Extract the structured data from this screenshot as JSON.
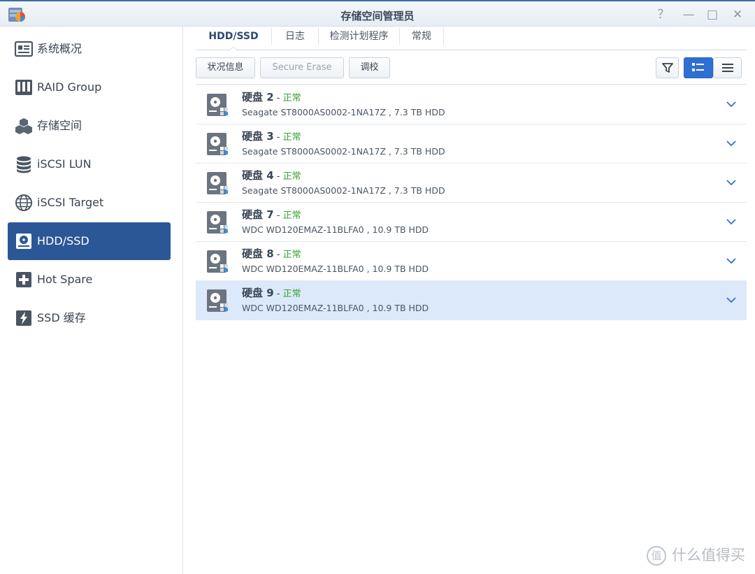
{
  "window": {
    "title": "存储空间管理员",
    "help_glyph": "？",
    "minimize_glyph": "—",
    "maximize_glyph": "□",
    "close_glyph": "✕"
  },
  "sidebar": {
    "items": [
      {
        "label": "系统概况",
        "icon": "overview-icon",
        "active": false
      },
      {
        "label": "RAID Group",
        "icon": "raid-group-icon",
        "active": false
      },
      {
        "label": "存储空间",
        "icon": "storage-pool-icon",
        "active": false
      },
      {
        "label": "iSCSI LUN",
        "icon": "database-icon",
        "active": false
      },
      {
        "label": "iSCSI Target",
        "icon": "globe-icon",
        "active": false
      },
      {
        "label": "HDD/SSD",
        "icon": "hdd-icon",
        "active": true
      },
      {
        "label": "Hot Spare",
        "icon": "hot-spare-icon",
        "active": false
      },
      {
        "label": "SSD 缓存",
        "icon": "ssd-cache-icon",
        "active": false
      }
    ]
  },
  "tabs": [
    {
      "label": "HDD/SSD",
      "active": true
    },
    {
      "label": "日志",
      "active": false
    },
    {
      "label": "检测计划程序",
      "active": false
    },
    {
      "label": "常规",
      "active": false
    }
  ],
  "toolbar": {
    "status_info": "状况信息",
    "secure_erase": "Secure Erase",
    "calibrate": "调校"
  },
  "disks": [
    {
      "name": "硬盘 2",
      "status": "正常",
      "detail": "Seagate ST8000AS0002-1NA17Z , 7.3 TB HDD",
      "selected": false
    },
    {
      "name": "硬盘 3",
      "status": "正常",
      "detail": "Seagate ST8000AS0002-1NA17Z , 7.3 TB HDD",
      "selected": false
    },
    {
      "name": "硬盘 4",
      "status": "正常",
      "detail": "Seagate ST8000AS0002-1NA17Z , 7.3 TB HDD",
      "selected": false
    },
    {
      "name": "硬盘 7",
      "status": "正常",
      "detail": "WDC WD120EMAZ-11BLFA0 , 10.9 TB HDD",
      "selected": false
    },
    {
      "name": "硬盘 8",
      "status": "正常",
      "detail": "WDC WD120EMAZ-11BLFA0 , 10.9 TB HDD",
      "selected": false
    },
    {
      "name": "硬盘 9",
      "status": "正常",
      "detail": "WDC WD120EMAZ-11BLFA0 , 10.9 TB HDD",
      "selected": true
    }
  ],
  "status_separator": " - ",
  "watermark": {
    "mark": "值",
    "text": "什么值得买"
  },
  "colors": {
    "accent": "#2b5796",
    "status_ok": "#3aa135",
    "selected_row": "#dce9fb",
    "toggle_selected": "#2f6fd4"
  }
}
